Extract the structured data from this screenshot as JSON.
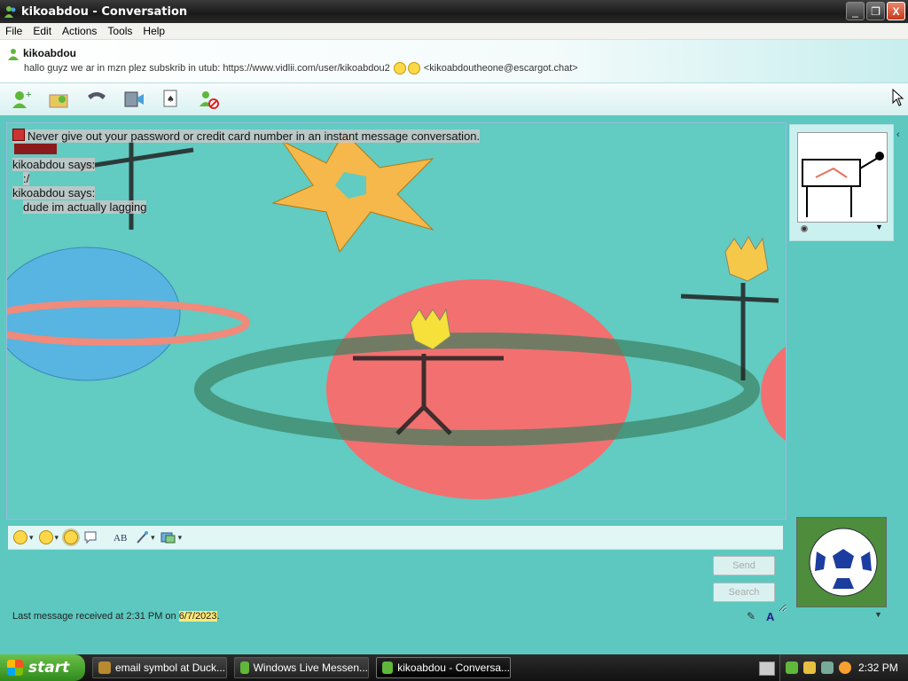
{
  "window": {
    "title": "kikoabdou - Conversation",
    "buttons": {
      "minimize": "_",
      "maximize": "❐",
      "close": "X"
    }
  },
  "menu": [
    "File",
    "Edit",
    "Actions",
    "Tools",
    "Help"
  ],
  "header": {
    "contact_name": "kikoabdou",
    "personal_message": "hallo guyz we ar in mzn plez subskrib in utub: https://www.vidlii.com/user/kikoabdou2",
    "email": "<kikoabdoutheone@escargot.chat>"
  },
  "toolbar": {
    "icons": [
      "invite-icon",
      "share-files-icon",
      "call-icon",
      "video-icon",
      "games-icon",
      "block-icon"
    ]
  },
  "chat": {
    "warning": "Never give out your password or credit card number in an instant message conversation.",
    "messages": [
      {
        "sender": "kikoabdou says:",
        "text": ":/"
      },
      {
        "sender": "kikoabdou says:",
        "text": "dude im actually lagging"
      }
    ]
  },
  "composer": {
    "send_label": "Send",
    "search_label": "Search",
    "status_prefix": "Last message received at 2:31 PM on ",
    "status_date": "6/7/2023",
    "status_suffix": ".",
    "font_label": "A"
  },
  "taskbar": {
    "start_label": "start",
    "tasks": [
      {
        "label": "email symbol at Duck...",
        "active": false
      },
      {
        "label": "Windows Live Messen...",
        "active": false
      },
      {
        "label": "kikoabdou - Conversa...",
        "active": true
      }
    ],
    "clock": "2:32 PM"
  },
  "colors": {
    "chat_background": "#5cc8c0",
    "title_bar": "#1a1a1a",
    "close_button": "#c4381b"
  }
}
